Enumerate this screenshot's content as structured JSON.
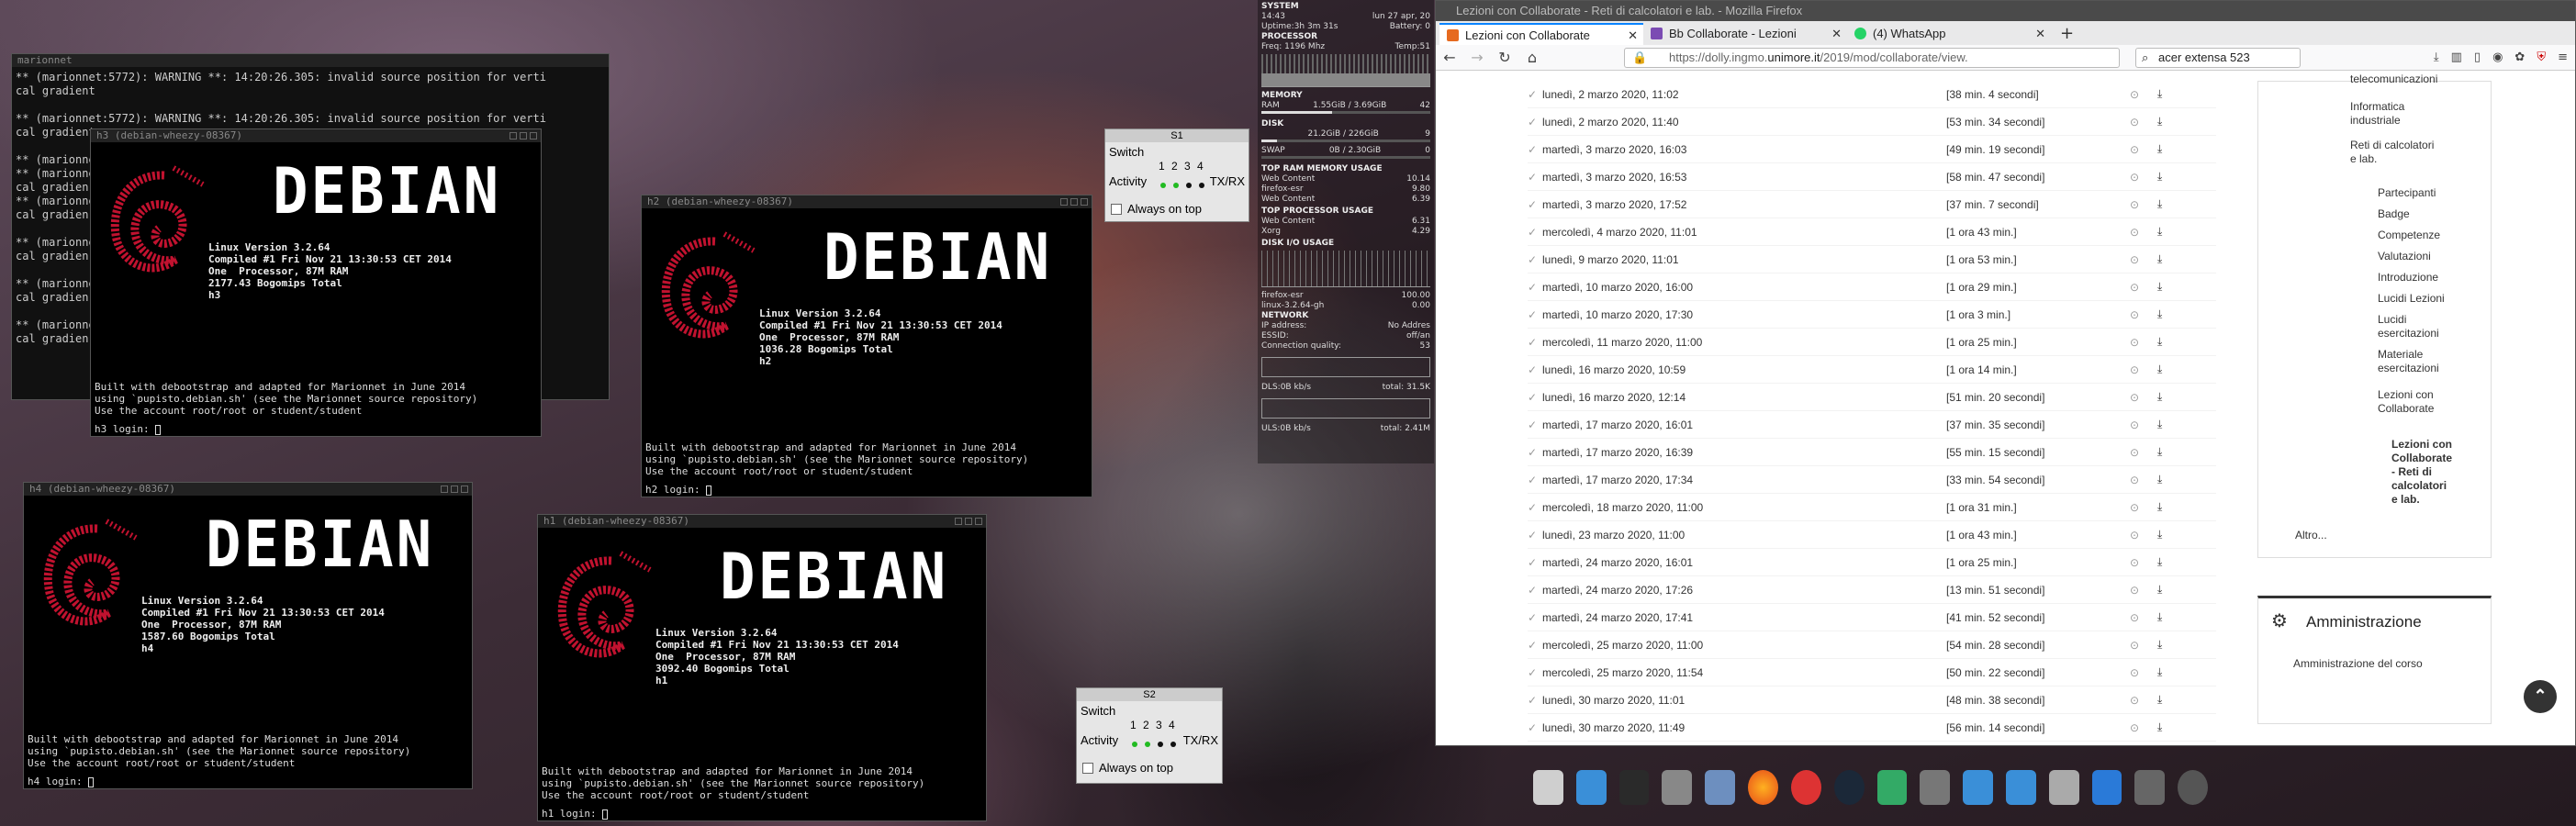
{
  "marionnet": {
    "title": "marionnet",
    "lines": [
      "** (marionnet:5772): WARNING **: 14:20:26.305: invalid source position for verti",
      "cal gradient",
      "",
      "** (marionnet:5772): WARNING **: 14:20:26.305: invalid source position for verti",
      "cal gradient",
      "",
      "** (marionnet",
      "** (marionnet",
      "cal gradien",
      "** (marionnet",
      "cal gradien",
      "",
      "** (marionnet",
      "cal gradien",
      "",
      "** (marionnet",
      "cal gradien",
      "",
      "** (marionnet",
      "cal gradien"
    ]
  },
  "vms": [
    {
      "title": "h3 (debian-wheezy-08367)",
      "word": "DEBIAN",
      "info": "Linux Version 3.2.64\nCompiled #1 Fri Nov 21 13:30:53 CET 2014\nOne  Processor, 87M RAM\n2177.43 Bogomips Total\nh3",
      "foot1": "Built with debootstrap and adapted for Marionnet in June 2014\nusing `pupisto.debian.sh' (see the Marionnet source repository)",
      "foot2": "Use the account root/root or student/student",
      "login": "h3 login: "
    },
    {
      "title": "h2 (debian-wheezy-08367)",
      "word": "DEBIAN",
      "info": "Linux Version 3.2.64\nCompiled #1 Fri Nov 21 13:30:53 CET 2014\nOne  Processor, 87M RAM\n1036.28 Bogomips Total\nh2",
      "foot1": "Built with debootstrap and adapted for Marionnet in June 2014\nusing `pupisto.debian.sh' (see the Marionnet source repository)",
      "foot2": "Use the account root/root or student/student",
      "login": "h2 login: "
    },
    {
      "title": "h4 (debian-wheezy-08367)",
      "word": "DEBIAN",
      "info": "Linux Version 3.2.64\nCompiled #1 Fri Nov 21 13:30:53 CET 2014\nOne  Processor, 87M RAM\n1587.60 Bogomips Total\nh4",
      "foot1": "Built with debootstrap and adapted for Marionnet in June 2014\nusing `pupisto.debian.sh' (see the Marionnet source repository)",
      "foot2": "Use the account root/root or student/student",
      "login": "h4 login: "
    },
    {
      "title": "h1 (debian-wheezy-08367)",
      "word": "DEBIAN",
      "info": "Linux Version 3.2.64\nCompiled #1 Fri Nov 21 13:30:53 CET 2014\nOne  Processor, 87M RAM\n3092.40 Bogomips Total\nh1",
      "foot1": "Built with debootstrap and adapted for Marionnet in June 2014\nusing `pupisto.debian.sh' (see the Marionnet source repository)",
      "foot2": "Use the account root/root or student/student",
      "login": "h1 login: "
    }
  ],
  "switches": [
    {
      "title": "S1",
      "name": "Switch",
      "ports": "1 2 3 4",
      "activity": "Activity",
      "txrx": "TX/RX",
      "ontop": "Always on top"
    },
    {
      "title": "S2",
      "name": "Switch",
      "ports": "1 2 3 4",
      "activity": "Activity",
      "txrx": "TX/RX",
      "ontop": "Always on top"
    }
  ],
  "conky": {
    "system": "SYSTEM",
    "time": "14:43",
    "date": "lun 27 apr, 20",
    "uptime": "Uptime:3h 3m 31s",
    "battery": "Battery: 0",
    "processor": "PROCESSOR",
    "freq": "Freq: 1196 Mhz",
    "temp": "Temp:51",
    "memory": "MEMORY",
    "ram_label": "RAM",
    "ram": "1.55GiB / 3.69GiB",
    "ram_pct": "42",
    "disk": "DISK",
    "disk_val": "21.2GiB / 226GiB",
    "disk_pct": "9",
    "swap_label": "SWAP",
    "swap": "0B / 2.30GiB",
    "swap_pct": "0",
    "topram": "TOP RAM MEMORY USAGE",
    "topram_rows": [
      [
        "Web Content",
        "10.14"
      ],
      [
        "firefox-esr",
        "9.80"
      ],
      [
        "Web Content",
        "6.39"
      ]
    ],
    "topproc": "TOP PROCESSOR USAGE",
    "topproc_rows": [
      [
        "Web Content",
        "6.31"
      ],
      [
        "Xorg",
        "4.29"
      ]
    ],
    "diskio": "DISK I/O USAGE",
    "proc_rows": [
      [
        "firefox-esr",
        "100.00"
      ],
      [
        "linux-3.2.64-gh",
        "0.00"
      ]
    ],
    "network": "NETWORK",
    "net_rows": [
      [
        "IP address:",
        "No Addres"
      ],
      [
        "ESSID:",
        "off/an"
      ],
      [
        "Connection quality:",
        "53"
      ]
    ],
    "dls": "DLS:0B   kb/s",
    "dls_total": "total: 31.5K",
    "uls": "ULS:0B   kb/s",
    "uls_total": "total: 2.41M"
  },
  "firefox": {
    "title": "Lezioni con Collaborate - Reti di calcolatori e lab. - Mozilla Firefox",
    "tabs": [
      "Lezioni con Collaborate",
      "Bb Collaborate - Lezioni",
      "(4) WhatsApp"
    ],
    "url_prefix": "https://dolly.ingmo.",
    "url_domain": "unimore.it",
    "url_suffix": "/2019/mod/collaborate/view.",
    "search": "acer extensa 523",
    "rows": [
      [
        "lunedì, 2 marzo 2020, 11:02",
        "[38 min. 4 secondi]"
      ],
      [
        "lunedì, 2 marzo 2020, 11:40",
        "[53 min. 34 secondi]"
      ],
      [
        "martedì, 3 marzo 2020, 16:03",
        "[49 min. 19 secondi]"
      ],
      [
        "martedì, 3 marzo 2020, 16:53",
        "[58 min. 47 secondi]"
      ],
      [
        "martedì, 3 marzo 2020, 17:52",
        "[37 min. 7 secondi]"
      ],
      [
        "mercoledì, 4 marzo 2020, 11:01",
        "[1 ora 43 min.]"
      ],
      [
        "lunedì, 9 marzo 2020, 11:01",
        "[1 ora 53 min.]"
      ],
      [
        "martedì, 10 marzo 2020, 16:00",
        "[1 ora 29 min.]"
      ],
      [
        "martedì, 10 marzo 2020, 17:30",
        "[1 ora 3 min.]"
      ],
      [
        "mercoledì, 11 marzo 2020, 11:00",
        "[1 ora 25 min.]"
      ],
      [
        "lunedì, 16 marzo 2020, 10:59",
        "[1 ora 14 min.]"
      ],
      [
        "lunedì, 16 marzo 2020, 12:14",
        "[51 min. 20 secondi]"
      ],
      [
        "martedì, 17 marzo 2020, 16:01",
        "[37 min. 35 secondi]"
      ],
      [
        "martedì, 17 marzo 2020, 16:39",
        "[55 min. 15 secondi]"
      ],
      [
        "martedì, 17 marzo 2020, 17:34",
        "[33 min. 54 secondi]"
      ],
      [
        "mercoledì, 18 marzo 2020, 11:00",
        "[1 ora 31 min.]"
      ],
      [
        "lunedì, 23 marzo 2020, 11:00",
        "[1 ora 43 min.]"
      ],
      [
        "martedì, 24 marzo 2020, 16:01",
        "[1 ora 25 min.]"
      ],
      [
        "martedì, 24 marzo 2020, 17:26",
        "[13 min. 51 secondi]"
      ],
      [
        "martedì, 24 marzo 2020, 17:41",
        "[41 min. 52 secondi]"
      ],
      [
        "mercoledì, 25 marzo 2020, 11:00",
        "[54 min. 28 secondi]"
      ],
      [
        "mercoledì, 25 marzo 2020, 11:54",
        "[50 min. 22 secondi]"
      ],
      [
        "lunedì, 30 marzo 2020, 11:01",
        "[48 min. 38 secondi]"
      ],
      [
        "lunedì, 30 marzo 2020, 11:49",
        "[56 min. 14 secondi]"
      ]
    ],
    "side": [
      "telecomunicazioni",
      "Informatica industriale",
      "Reti di calcolatori e lab.",
      "Partecipanti",
      "Badge",
      "Competenze",
      "Valutazioni",
      "Introduzione",
      "Lucidi Lezioni",
      "Lucidi esercitazioni",
      "Materiale esercitazioni",
      "Lezioni con Collaborate",
      "Lezioni con Collaborate - Reti di calcolatori e lab.",
      "Altro..."
    ],
    "admin_title": "Amministrazione",
    "admin_item": "Amministrazione del corso"
  }
}
